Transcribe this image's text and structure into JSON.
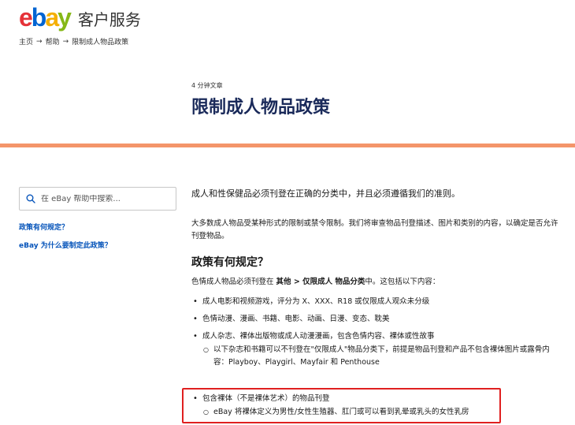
{
  "header": {
    "logo_e": "e",
    "logo_b": "b",
    "logo_a": "a",
    "logo_y": "y",
    "service_title": "客户服务",
    "logo_colors": {
      "e": "#e53238",
      "b": "#0064d2",
      "a": "#f5af02",
      "y": "#86b817"
    }
  },
  "breadcrumb": {
    "items": [
      "主页",
      "帮助",
      "限制成人物品政策"
    ],
    "separator": "→"
  },
  "article": {
    "read_time": "4 分钟文章",
    "title": "限制成人物品政策"
  },
  "accent_color": "#f4956a",
  "sidebar": {
    "search_placeholder": "在 eBay 帮助中搜索...",
    "links": [
      "政策有何规定？",
      "eBay 为什么要制定此政策？"
    ]
  },
  "content": {
    "intro": "成人和性保健品必须刊登在正确的分类中，并且必须遵循我们的准则。",
    "para1": "大多数成人物品受某种形式的限制或禁令限制。我们将审查物品刊登描述、图片和类别的内容，以确定是否允许刊登物品。",
    "section_title": "政策有何规定？",
    "lead_prefix": "色情成人物品必须刊登在 ",
    "lead_bold": "其他 > 仅限成人 物品分类",
    "lead_suffix": "中。这包括以下内容：",
    "bullets": [
      "成人电影和视频游戏，评分为 X、XXX、R18 或仅限成人观众未分级",
      "色情动漫、漫画、书籍、电影、动画、日漫、变态、耽美",
      "成人杂志、裸体出版物或成人动漫漫画，包含色情内容、裸体或性故事"
    ],
    "sub_bullet_3": "以下杂志和书籍可以不刊登在\"仅限成人\"物品分类下，前提是物品刊登和产品不包含裸体图片或露骨内容：Playboy、Playgirl、Mayfair 和 Penthouse",
    "highlighted_bullet": "包含裸体（不是裸体艺术）的物品刊登",
    "highlighted_sub": "eBay 将裸体定义为男性/女性生殖器、肛门或可以看到乳晕或乳头的女性乳房",
    "highlight_color": "#e02020"
  }
}
